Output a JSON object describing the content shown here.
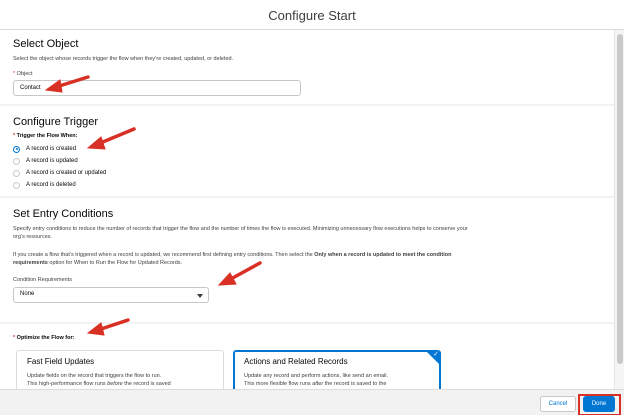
{
  "modal": {
    "title": "Configure Start"
  },
  "select_object": {
    "title": "Select Object",
    "description": "Select the object whose records trigger the flow when they’re created, updated, or deleted.",
    "object_label_required": "*",
    "object_label": "Object",
    "object_value": "Contact"
  },
  "configure_trigger": {
    "title": "Configure Trigger",
    "trigger_label_required": "*",
    "trigger_label": "Trigger the Flow When:",
    "options": [
      {
        "label": "A record is created",
        "checked": true
      },
      {
        "label": "A record is updated",
        "checked": false
      },
      {
        "label": "A record is created or updated",
        "checked": false
      },
      {
        "label": "A record is deleted",
        "checked": false
      }
    ]
  },
  "entry_conditions": {
    "title": "Set Entry Conditions",
    "description": "Specify entry conditions to reduce the number of records that trigger the flow and the number of times the flow is executed. Minimizing unnecessary flow executions helps to conserve your org’s resources.",
    "note_prefix": "If you create a flow that’s triggered when a record is updated, we recommend first defining entry conditions. Then select the ",
    "note_bold": "Only when a record is updated to meet the condition requirements",
    "note_suffix": " option for When to Run the Flow for Updated Records.",
    "condition_label": "Condition Requirements",
    "condition_value": "None"
  },
  "optimize": {
    "label_required": "*",
    "label": "Optimize the Flow for:",
    "cards": [
      {
        "title": "Fast Field Updates",
        "line1": "Update fields on the record that triggers the flow to run.",
        "line2_prefix": "This high-performance flow runs ",
        "line2_em": "before",
        "line2_suffix": " the record is saved",
        "selected": false
      },
      {
        "title": "Actions and Related Records",
        "line1": "Update any record and perform actions, like send an email.",
        "line2_prefix": "This more flexible flow runs ",
        "line2_em": "after",
        "line2_suffix": " the record is saved to the",
        "selected": true
      }
    ]
  },
  "footer": {
    "cancel_label": "Cancel",
    "done_label": "Done"
  },
  "colors": {
    "brand": "#0176d3",
    "annotation": "#d93025"
  }
}
